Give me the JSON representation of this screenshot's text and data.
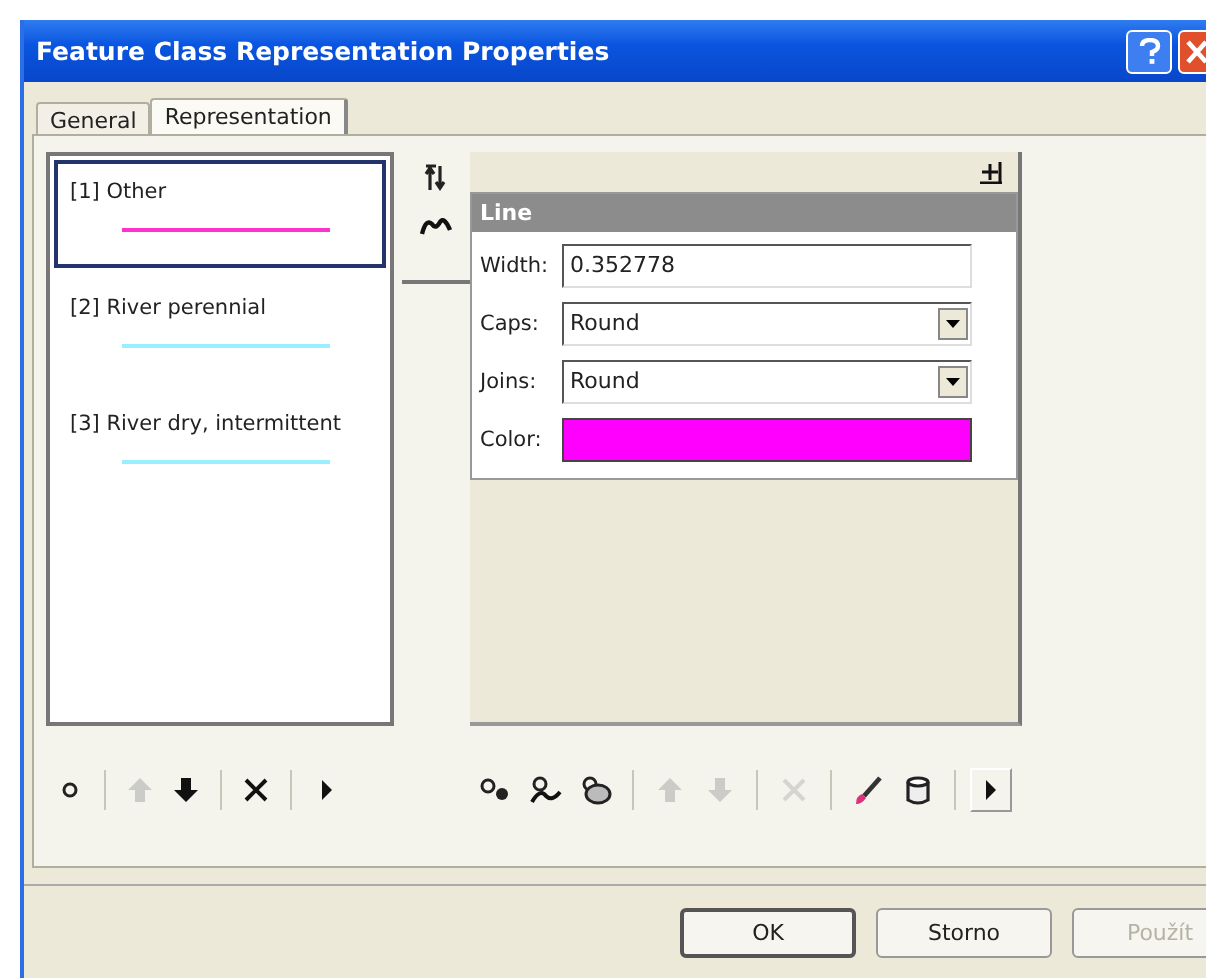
{
  "window": {
    "title": "Feature Class Representation Properties"
  },
  "tabs": [
    {
      "label": "General",
      "selected": false
    },
    {
      "label": "Representation",
      "selected": true
    }
  ],
  "rules": [
    {
      "label": "[1] Other",
      "color": "#ff33cc",
      "selected": true
    },
    {
      "label": "[2] River perennial",
      "color": "#99eeff",
      "selected": false
    },
    {
      "label": "[3] River dry, intermittent",
      "color": "#99eeff",
      "selected": false
    }
  ],
  "side_tools": [
    {
      "kind": "order",
      "disabled": false
    },
    {
      "kind": "line",
      "disabled": false
    }
  ],
  "layer": {
    "title": "Line",
    "properties": [
      {
        "kind": "text",
        "label": "Width:",
        "value": "0.352778"
      },
      {
        "kind": "dropdown",
        "label": "Caps:",
        "value": "Round"
      },
      {
        "kind": "dropdown",
        "label": "Joins:",
        "value": "Round"
      },
      {
        "kind": "color",
        "label": "Color:",
        "color": "#ff00ff"
      }
    ]
  },
  "rule_tools": [
    {
      "kind": "point",
      "disabled": false
    },
    {
      "kind": "up",
      "disabled": true
    },
    {
      "kind": "down",
      "disabled": false
    },
    {
      "kind": "delete",
      "disabled": false
    },
    {
      "kind": "more",
      "disabled": false
    }
  ],
  "layer_tools": [
    {
      "kind": "add-marker",
      "disabled": false
    },
    {
      "kind": "add-line",
      "disabled": false
    },
    {
      "kind": "add-fill",
      "disabled": false
    },
    {
      "kind": "up",
      "disabled": true
    },
    {
      "kind": "down",
      "disabled": true
    },
    {
      "kind": "delete",
      "disabled": true
    },
    {
      "kind": "brush",
      "disabled": false
    },
    {
      "kind": "cylinder",
      "disabled": false
    },
    {
      "kind": "more",
      "disabled": false
    }
  ],
  "buttons": [
    {
      "label": "OK",
      "disabled": false
    },
    {
      "label": "Storno",
      "disabled": false
    },
    {
      "label": "Použít",
      "disabled": true
    }
  ]
}
